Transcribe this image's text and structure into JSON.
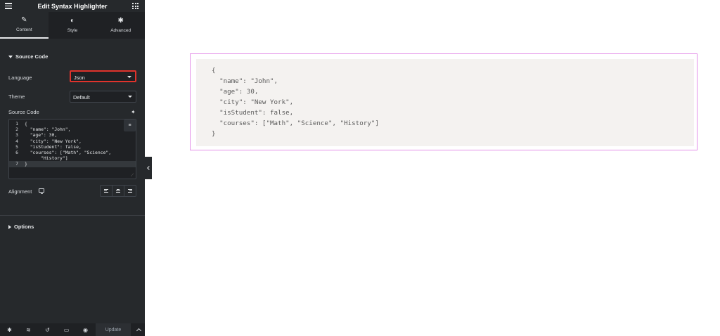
{
  "panel": {
    "title": "Edit Syntax Highlighter",
    "tabs": [
      {
        "label": "Content",
        "icon": "pencil-icon",
        "active": true
      },
      {
        "label": "Style",
        "icon": "half-circle-icon",
        "active": false
      },
      {
        "label": "Advanced",
        "icon": "gear-icon",
        "active": false
      }
    ],
    "section_source": "Source Code",
    "language": {
      "label": "Language",
      "value": "Json"
    },
    "theme": {
      "label": "Theme",
      "value": "Default"
    },
    "source_code_label": "Source Code",
    "code_lines": [
      {
        "num": "1",
        "text": "{"
      },
      {
        "num": "2",
        "text": "  \"name\": \"John\","
      },
      {
        "num": "3",
        "text": "  \"age\": 30,"
      },
      {
        "num": "4",
        "text": "  \"city\": \"New York\","
      },
      {
        "num": "5",
        "text": "  \"isStudent\": false,"
      },
      {
        "num": "6",
        "text": "  \"courses\": [\"Math\", \"Science\","
      },
      {
        "num": "",
        "text": "      \"History\"]"
      },
      {
        "num": "7",
        "text": "}"
      }
    ],
    "alignment_label": "Alignment",
    "section_options": "Options",
    "footer": {
      "update_label": "Update"
    }
  },
  "preview": {
    "code_lines": [
      "{",
      "  \"name\": \"John\",",
      "  \"age\": 30,",
      "  \"city\": \"New York\",",
      "  \"isStudent\": false,",
      "  \"courses\": [\"Math\", \"Science\", \"History\"]",
      "}"
    ]
  },
  "colors": {
    "panel_bg": "#26292c",
    "highlight_border": "#e0332c",
    "widget_outline": "#e38fe8",
    "code_bg": "#f4f2f0"
  }
}
